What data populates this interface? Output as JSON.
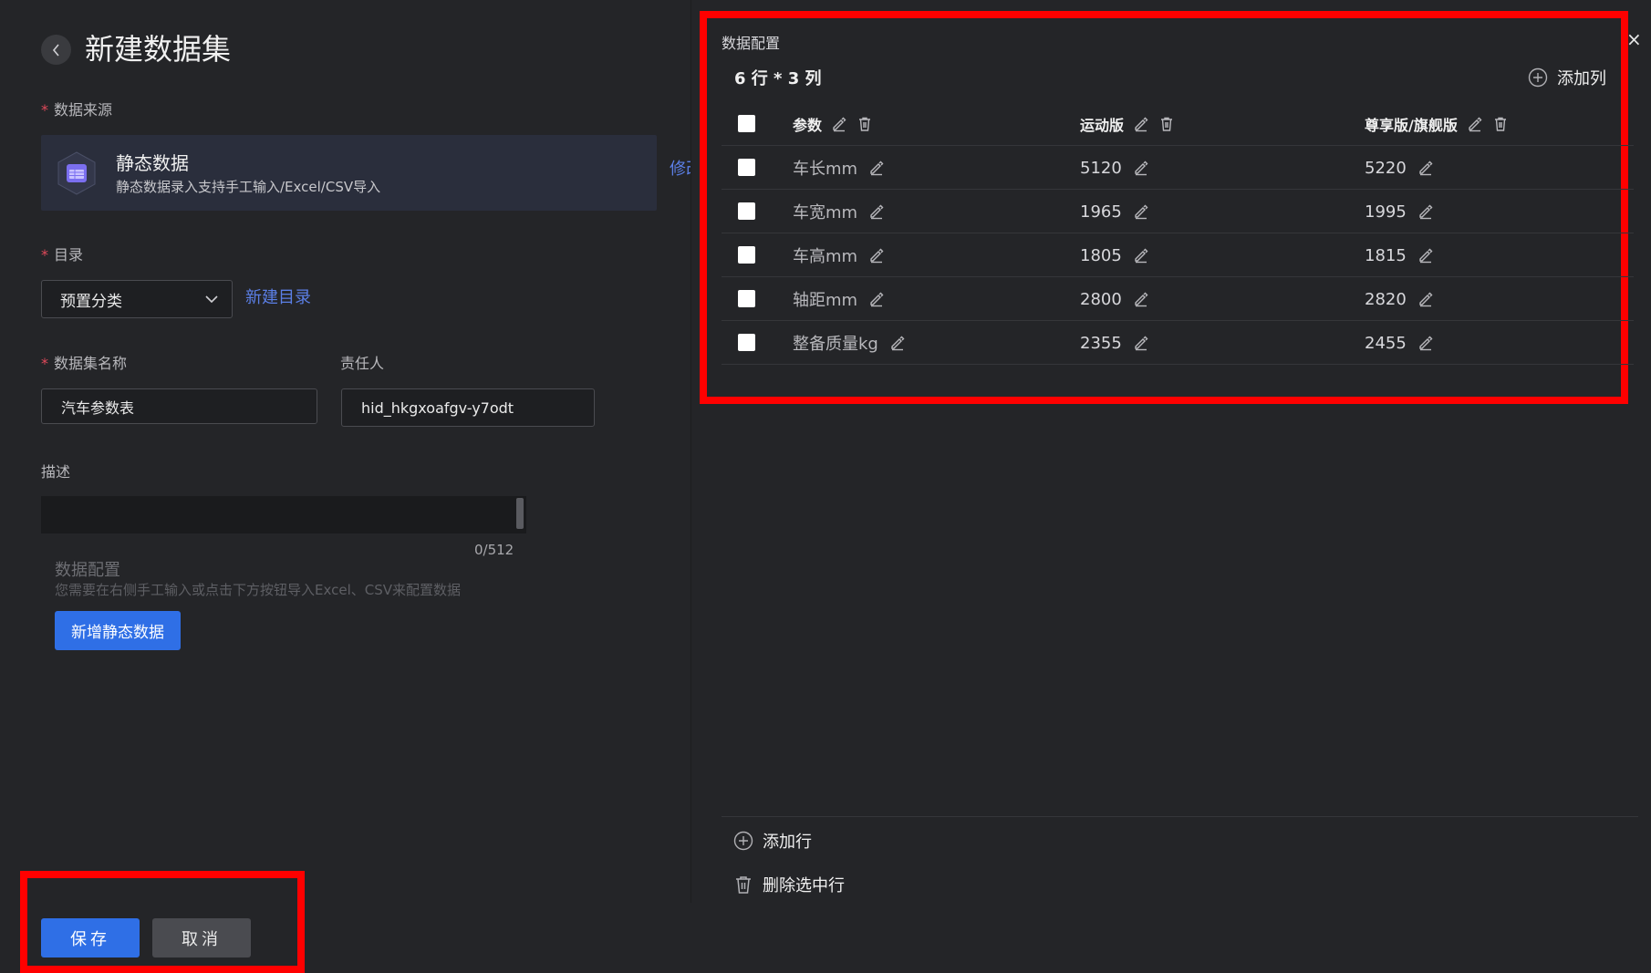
{
  "page": {
    "title": "新建数据集"
  },
  "form": {
    "source": {
      "label": "数据来源",
      "card_name": "静态数据",
      "card_desc": "静态数据录入支持手工输入/Excel/CSV导入",
      "modify_link": "修改"
    },
    "directory": {
      "label": "目录",
      "selected": "预置分类",
      "new_link": "新建目录"
    },
    "dataset_name": {
      "label": "数据集名称",
      "value": "汽车参数表"
    },
    "owner": {
      "label": "责任人",
      "value": "hid_hkgxoafgv-y7odt"
    },
    "description": {
      "label": "描述",
      "value": "",
      "counter": "0/512"
    },
    "data_config": {
      "title": "数据配置",
      "hint": "您需要在右侧手工输入或点击下方按钮导入Excel、CSV来配置数据",
      "add_button": "新增静态数据"
    },
    "actions": {
      "save": "保存",
      "cancel": "取消"
    }
  },
  "panel": {
    "title": "数据配置",
    "close": "×",
    "size_text": "6 行 * 3 列",
    "add_column": "添加列",
    "columns": [
      "参数",
      "运动版",
      "尊享版/旗舰版"
    ],
    "rows": [
      [
        "车长mm",
        "5120",
        "5220"
      ],
      [
        "车宽mm",
        "1965",
        "1995"
      ],
      [
        "车高mm",
        "1805",
        "1815"
      ],
      [
        "轴距mm",
        "2800",
        "2820"
      ],
      [
        "整备质量kg",
        "2355",
        "2455"
      ]
    ],
    "add_row": "添加行",
    "delete_selected": "删除选中行"
  },
  "colors": {
    "background": "#242528",
    "accent": "#2f6fe6",
    "link": "#5b7fe6",
    "required": "#e0495a",
    "highlight_box": "#ff0000"
  }
}
